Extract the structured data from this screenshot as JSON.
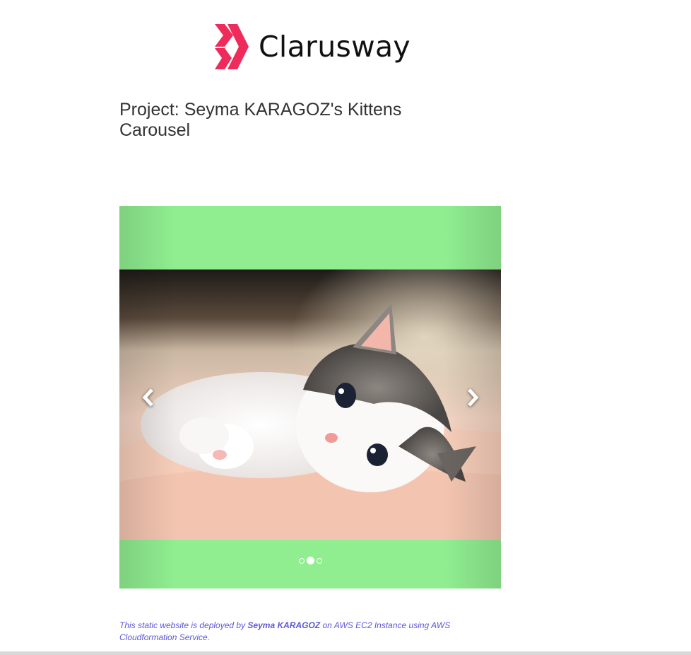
{
  "brand": {
    "name": "Clarusway",
    "mark_color": "#ee2b5b"
  },
  "project": {
    "title": "Project: Seyma KARAGOZ's Kittens Carousel"
  },
  "carousel": {
    "background_color": "#90ee90",
    "active_slide": 2,
    "slide_count": 3,
    "prev_icon": "chevron-left-icon",
    "next_icon": "chevron-right-icon"
  },
  "footer": {
    "text_before": "This static website is deployed by ",
    "author": "Seyma KARAGOZ",
    "text_after": " on AWS EC2 Instance using AWS Cloudformation Service.",
    "color": "#5b58d8"
  }
}
